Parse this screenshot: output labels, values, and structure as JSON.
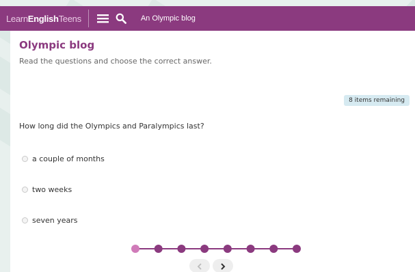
{
  "header": {
    "logo_learn": "Learn",
    "logo_english": "English",
    "logo_teens": "Teens",
    "title": "An Olympic blog",
    "menu_icon": "menu-icon",
    "search_icon": "search-icon",
    "color": "#8b3a7f"
  },
  "main": {
    "title": "Olympic blog",
    "instructions": "Read the questions and choose the correct answer.",
    "remaining": "8 items remaining",
    "question": "How long did the Olympics and Paralympics last?",
    "options": [
      {
        "label": "a couple of months",
        "selected": false
      },
      {
        "label": "two weeks",
        "selected": false
      },
      {
        "label": "seven years",
        "selected": false
      }
    ]
  },
  "progress": {
    "total_items": 8,
    "current_item": 1,
    "active_color": "#d07bb9",
    "inactive_color": "#8b3a7f"
  },
  "navigation": {
    "prev_icon": "chevron-left-icon",
    "next_icon": "chevron-right-icon"
  }
}
